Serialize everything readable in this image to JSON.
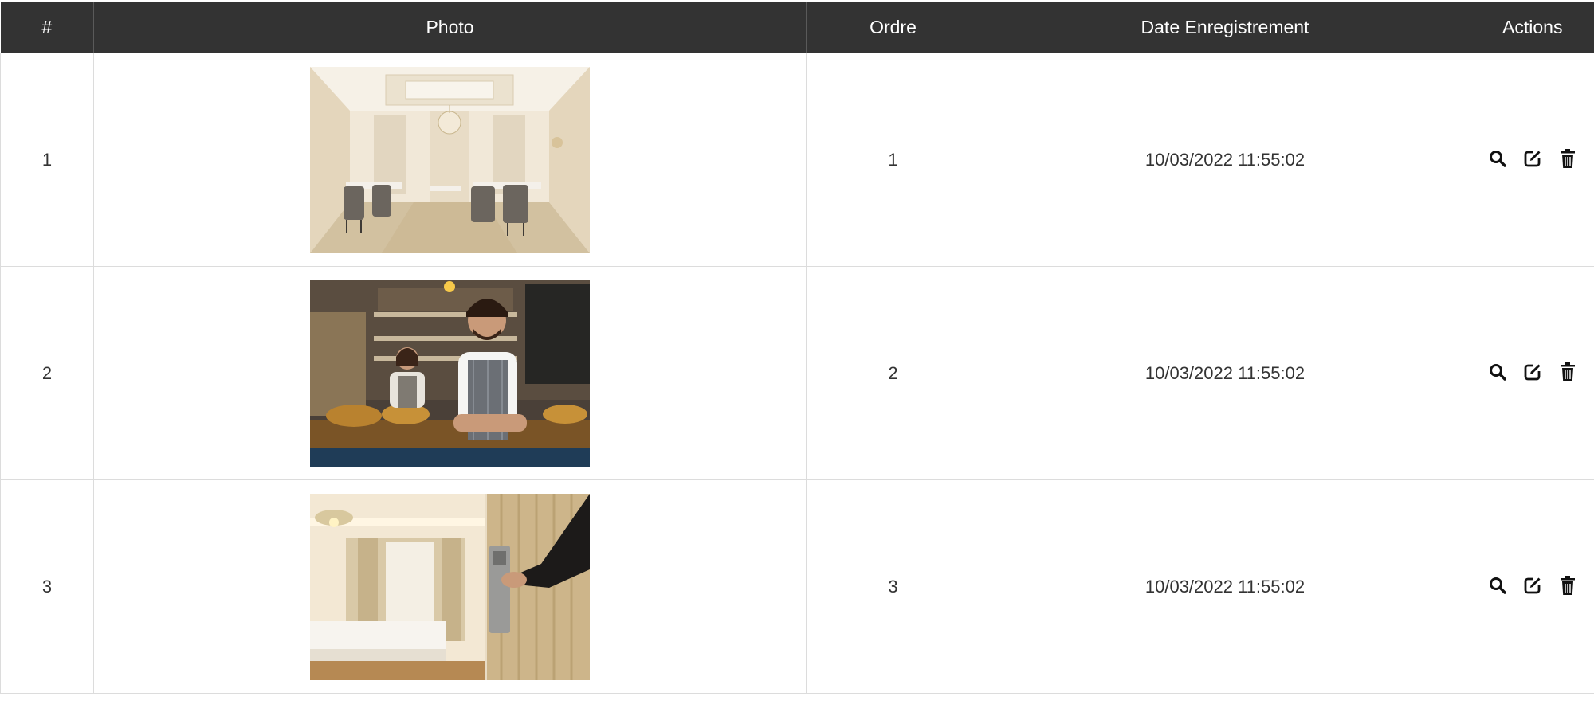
{
  "table": {
    "columns": [
      "#",
      "Photo",
      "Ordre",
      "Date Enregistrement",
      "Actions"
    ],
    "rows": [
      {
        "num": "1",
        "photo": "restaurant-interior-photo",
        "ordre": "1",
        "date": "10/03/2022 11:55:02"
      },
      {
        "num": "2",
        "photo": "bakery-staff-photo",
        "ordre": "2",
        "date": "10/03/2022 11:55:02"
      },
      {
        "num": "3",
        "photo": "hotel-room-door-photo",
        "ordre": "3",
        "date": "10/03/2022 11:55:02"
      }
    ],
    "actions": [
      "search-icon",
      "edit-icon",
      "trash-icon"
    ]
  },
  "colors": {
    "header_bg": "#333333",
    "header_text": "#ffffff",
    "border": "#dcdcdc",
    "text": "#333333"
  }
}
